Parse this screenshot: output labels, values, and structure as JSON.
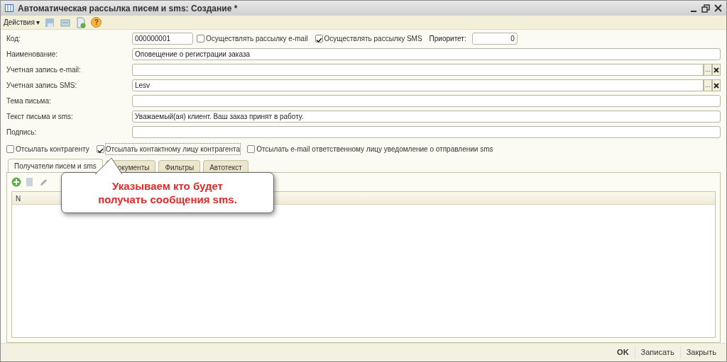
{
  "window": {
    "title": "Автоматическая рассылка писем и sms: Создание *"
  },
  "toolbar": {
    "actions_menu": "Действия",
    "menu_arrow": "▾",
    "help": "?"
  },
  "header_row": {
    "code_label": "Код:",
    "code_value": "000000001",
    "checks": [
      {
        "label": "Осуществлять рассылку e-mail",
        "checked": false
      },
      {
        "label": "Осуществлять рассылку SMS",
        "checked": true
      }
    ],
    "priority_label": "Приоритет:",
    "priority_value": "0"
  },
  "fields": [
    {
      "label": "Наименование:",
      "value": "Оповещение о регистрации заказа",
      "kind": "text"
    },
    {
      "label": "Учетная запись e-mail:",
      "kind": "select",
      "choose": "..."
    },
    {
      "label": "Учетная запись SMS:",
      "value": "Lesv",
      "kind": "select",
      "choose": "..."
    },
    {
      "label": "Тема письма:",
      "kind": "text"
    },
    {
      "label": "Текст письма и sms:",
      "value": "Уважаемый(ая) клиент. Ваш заказ принят в работу.",
      "kind": "text"
    },
    {
      "label": "Подпись:",
      "kind": "text"
    }
  ],
  "options": [
    {
      "label": "Отсылать контрагенту",
      "checked": false
    },
    {
      "label": "Отсылать контактному лицу контрагента",
      "checked": true
    },
    {
      "label": "Отсылать e-mail ответственному лицу уведомление о отправлении sms",
      "checked": false
    }
  ],
  "tabs": [
    {
      "label": "Получатели писем и sms",
      "selected": true
    },
    {
      "label": "окументы",
      "selected": false
    },
    {
      "label": "Фильтры",
      "selected": false
    },
    {
      "label": "Автотекст",
      "selected": false
    }
  ],
  "table": {
    "columns": [
      "N"
    ]
  },
  "callout": {
    "text": "Указываем кто будет получать сообщения sms."
  },
  "footer": {
    "buttons": [
      "OK",
      "Записать",
      "Закрыть"
    ]
  }
}
